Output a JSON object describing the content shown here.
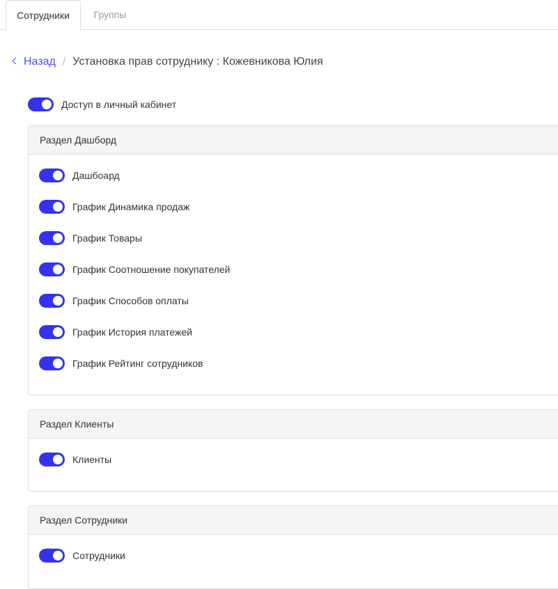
{
  "tabs": [
    {
      "label": "Сотрудники",
      "active": true
    },
    {
      "label": "Группы",
      "active": false
    }
  ],
  "breadcrumb": {
    "back_label": "Назад",
    "separator": "/",
    "title": "Установка прав сотруднику : Кожевникова Юлия"
  },
  "access": {
    "label": "Доступ в личный кабинет",
    "enabled": true
  },
  "sections": [
    {
      "title": "Раздел Дашборд",
      "items": [
        {
          "label": "Дашбоард",
          "enabled": true
        },
        {
          "label": "График Динамика продаж",
          "enabled": true
        },
        {
          "label": "График Товары",
          "enabled": true
        },
        {
          "label": "График Соотношение покупателей",
          "enabled": true
        },
        {
          "label": "График Способов оплаты",
          "enabled": true
        },
        {
          "label": "График История платежей",
          "enabled": true
        },
        {
          "label": "График Рейтинг сотрудников",
          "enabled": true
        }
      ]
    },
    {
      "title": "Раздел Клиенты",
      "items": [
        {
          "label": "Клиенты",
          "enabled": true
        }
      ]
    },
    {
      "title": "Раздел Сотрудники",
      "items": [
        {
          "label": "Сотрудники",
          "enabled": true
        }
      ]
    }
  ],
  "colors": {
    "accent": "#3333ee",
    "link": "#4a4ef0",
    "panel_header_bg": "#f5f5f5"
  }
}
